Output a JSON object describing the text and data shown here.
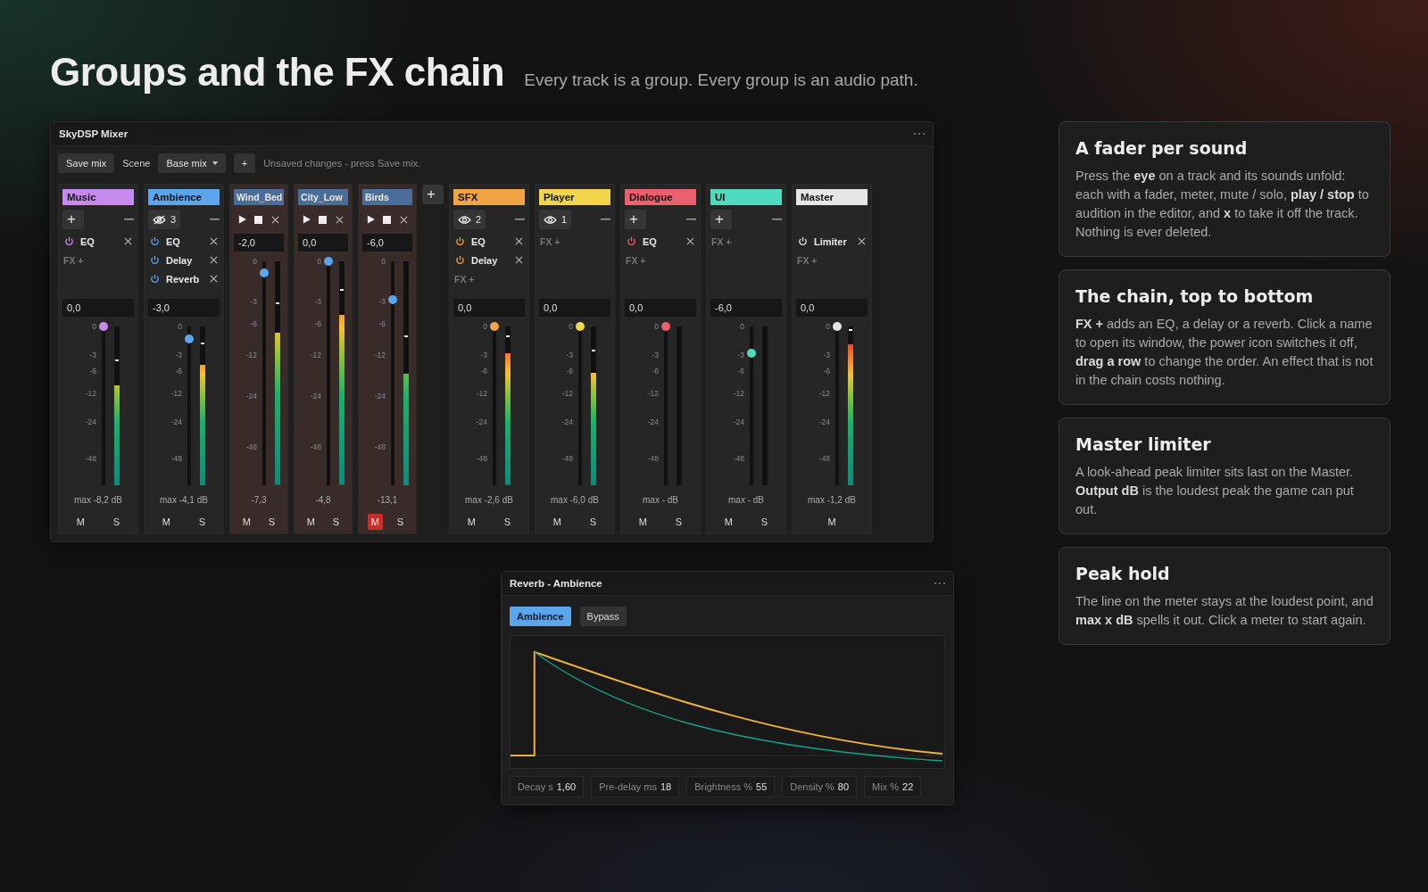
{
  "page": {
    "title": "Groups and the FX chain",
    "subtitle": "Every track is a group. Every group is an audio path."
  },
  "mixer": {
    "title": "SkyDSP Mixer",
    "toolbar": {
      "save_button": "Save mix",
      "scene_label": "Scene",
      "scene_value": "Base mix",
      "add_button": "+",
      "status": "Unsaved changes - press Save mix."
    },
    "strips": [
      {
        "name": "Music",
        "color": "#c98af0",
        "header": {
          "kind": "add",
          "label": "+"
        },
        "fx": [
          {
            "name": "EQ",
            "on": true
          }
        ],
        "fx_add": "FX +",
        "gain": "0,0",
        "scale": [
          "0",
          "-3",
          "-6",
          "-12",
          "-24",
          "-48"
        ],
        "fader": {
          "level": 1
        },
        "meter": {
          "level": 0.63,
          "peak_hold": {
            "level": 0.78
          }
        },
        "reading": "max -8,2 dB",
        "buttons": [
          {
            "label": "M",
            "selected": false
          },
          {
            "label": "S",
            "selected": false
          }
        ]
      },
      {
        "name": "Ambience",
        "color": "#5aa5ec",
        "header": {
          "kind": "eye",
          "count": "3",
          "expanded": true
        },
        "fx": [
          {
            "name": "EQ",
            "on": true
          },
          {
            "name": "Delay",
            "on": true
          },
          {
            "name": "Reverb",
            "on": true
          }
        ],
        "gain": "-3,0",
        "scale": [
          "0",
          "-3",
          "-6",
          "-12",
          "-24",
          "-48"
        ],
        "fader": {
          "level": 0.92
        },
        "meter": {
          "level": 0.76,
          "peak_hold": {
            "level": 0.89
          }
        },
        "reading": "max -4,1 dB",
        "buttons": [
          {
            "label": "M",
            "selected": false
          },
          {
            "label": "S",
            "selected": false
          }
        ],
        "children": [
          {
            "name": "Wind_Bed",
            "color": "#4b6d99",
            "header": {
              "kind": "transport"
            },
            "gain": "-2,0",
            "scale": [
              "0",
              "-3",
              "-6",
              "-12",
              "-24",
              "-48"
            ],
            "fader": {
              "level": 0.95
            },
            "meter": {
              "level": 0.68,
              "peak_hold": {
                "level": 0.81
              }
            },
            "reading": "-7,3",
            "buttons": [
              {
                "label": "M",
                "selected": false
              },
              {
                "label": "S",
                "selected": false
              }
            ]
          },
          {
            "name": "City_Low",
            "color": "#4b6d99",
            "header": {
              "kind": "transport"
            },
            "gain": "0,0",
            "scale": [
              "0",
              "-3",
              "-6",
              "-12",
              "-24",
              "-48"
            ],
            "fader": {
              "level": 1
            },
            "meter": {
              "level": 0.76,
              "peak_hold": {
                "level": 0.87
              }
            },
            "reading": "-4,8",
            "buttons": [
              {
                "label": "M",
                "selected": false
              },
              {
                "label": "S",
                "selected": false
              }
            ]
          },
          {
            "name": "Birds",
            "color": "#4b6d99",
            "header": {
              "kind": "transport"
            },
            "gain": "-6,0",
            "scale": [
              "0",
              "-3",
              "-6",
              "-12",
              "-24",
              "-48"
            ],
            "fader": {
              "level": 0.83
            },
            "meter": {
              "level": 0.5,
              "peak_hold": {
                "level": 0.66
              }
            },
            "reading": "-13,1",
            "buttons": [
              {
                "label": "M",
                "selected": true
              },
              {
                "label": "S",
                "selected": false
              }
            ]
          }
        ],
        "add_child": "+"
      },
      {
        "name": "SFX",
        "color": "#f2a444",
        "header": {
          "kind": "eye",
          "count": "2",
          "expanded": false
        },
        "fx": [
          {
            "name": "EQ",
            "on": true
          },
          {
            "name": "Delay",
            "on": true
          }
        ],
        "fx_add": "FX +",
        "gain": "0,0",
        "scale": [
          "0",
          "-3",
          "-6",
          "-12",
          "-24",
          "-48"
        ],
        "fader": {
          "level": 1
        },
        "meter": {
          "level": 0.83,
          "peak_hold": {
            "level": 0.93
          }
        },
        "reading": "max -2,6 dB",
        "buttons": [
          {
            "label": "M",
            "selected": false
          },
          {
            "label": "S",
            "selected": false
          }
        ]
      },
      {
        "name": "Player",
        "color": "#f1d54a",
        "header": {
          "kind": "eye",
          "count": "1",
          "expanded": false
        },
        "fx_add": "FX +",
        "gain": "0,0",
        "scale": [
          "0",
          "-3",
          "-6",
          "-12",
          "-24",
          "-48"
        ],
        "fader": {
          "level": 1
        },
        "meter": {
          "level": 0.71,
          "peak_hold": {
            "level": 0.84
          }
        },
        "reading": "max -6,0 dB",
        "buttons": [
          {
            "label": "M",
            "selected": false
          },
          {
            "label": "S",
            "selected": false
          }
        ]
      },
      {
        "name": "Dialogue",
        "color": "#ec5f6e",
        "header": {
          "kind": "add",
          "label": "+"
        },
        "fx": [
          {
            "name": "EQ",
            "on": true
          }
        ],
        "fx_add": "FX +",
        "gain": "0,0",
        "scale": [
          "0",
          "-3",
          "-6",
          "-12",
          "-24",
          "-48"
        ],
        "fader": {
          "level": 1
        },
        "reading": "max - dB",
        "buttons": [
          {
            "label": "M",
            "selected": false
          },
          {
            "label": "S",
            "selected": false
          }
        ]
      },
      {
        "name": "UI",
        "color": "#4edbbd",
        "header": {
          "kind": "add",
          "label": "+"
        },
        "fx_add": "FX +",
        "gain": "-6,0",
        "scale": [
          "0",
          "-3",
          "-6",
          "-12",
          "-24",
          "-48"
        ],
        "fader": {
          "level": 0.83
        },
        "reading": "max - dB",
        "buttons": [
          {
            "label": "M",
            "selected": false
          },
          {
            "label": "S",
            "selected": false
          }
        ]
      },
      {
        "name": "Master",
        "color": "#e6e6e6",
        "header": {
          "kind": "none"
        },
        "fx": [
          {
            "name": "Limiter",
            "on": true
          }
        ],
        "fx_add": "FX +",
        "gain": "0,0",
        "scale": [
          "0",
          "-3",
          "-6",
          "-12",
          "-24",
          "-48"
        ],
        "fader": {
          "level": 1
        },
        "meter": {
          "level": 0.89,
          "peak_hold": {
            "level": 0.97
          }
        },
        "reading": "max -1,2 dB",
        "buttons": [
          {
            "label": "M",
            "selected": false
          }
        ]
      }
    ]
  },
  "reverb": {
    "title": "Reverb - Ambience",
    "tabs": [
      {
        "label": "Ambience",
        "selected": true
      },
      {
        "label": "Bypass",
        "selected": false
      }
    ],
    "params": [
      {
        "label": "Decay s",
        "value": "1,60"
      },
      {
        "label": "Pre-delay ms",
        "value": "18"
      },
      {
        "label": "Brightness %",
        "value": "55"
      },
      {
        "label": "Density %",
        "value": "80"
      },
      {
        "label": "Mix %",
        "value": "22"
      }
    ]
  },
  "cards": [
    {
      "title": "A fader per sound",
      "text": "Press the **eye** on a track and its sounds unfold: each with a fader, meter, mute / solo, **play / stop** to audition in the editor, and **x** to take it off the track. Nothing is ever deleted."
    },
    {
      "title": "The chain, top to bottom",
      "text": "**FX +** adds an EQ, a delay or a reverb. Click a name to open its window, the power icon switches it off, **drag a row** to change the order. An effect that is not in the chain costs nothing."
    },
    {
      "title": "Master limiter",
      "text": "A look-ahead peak limiter sits last on the Master. **Output dB** is the loudest peak the game can put out."
    },
    {
      "title": "Peak hold",
      "text": "The line on the meter stays at the loudest point, and **max x dB** spells it out. Click a meter to start again."
    }
  ]
}
